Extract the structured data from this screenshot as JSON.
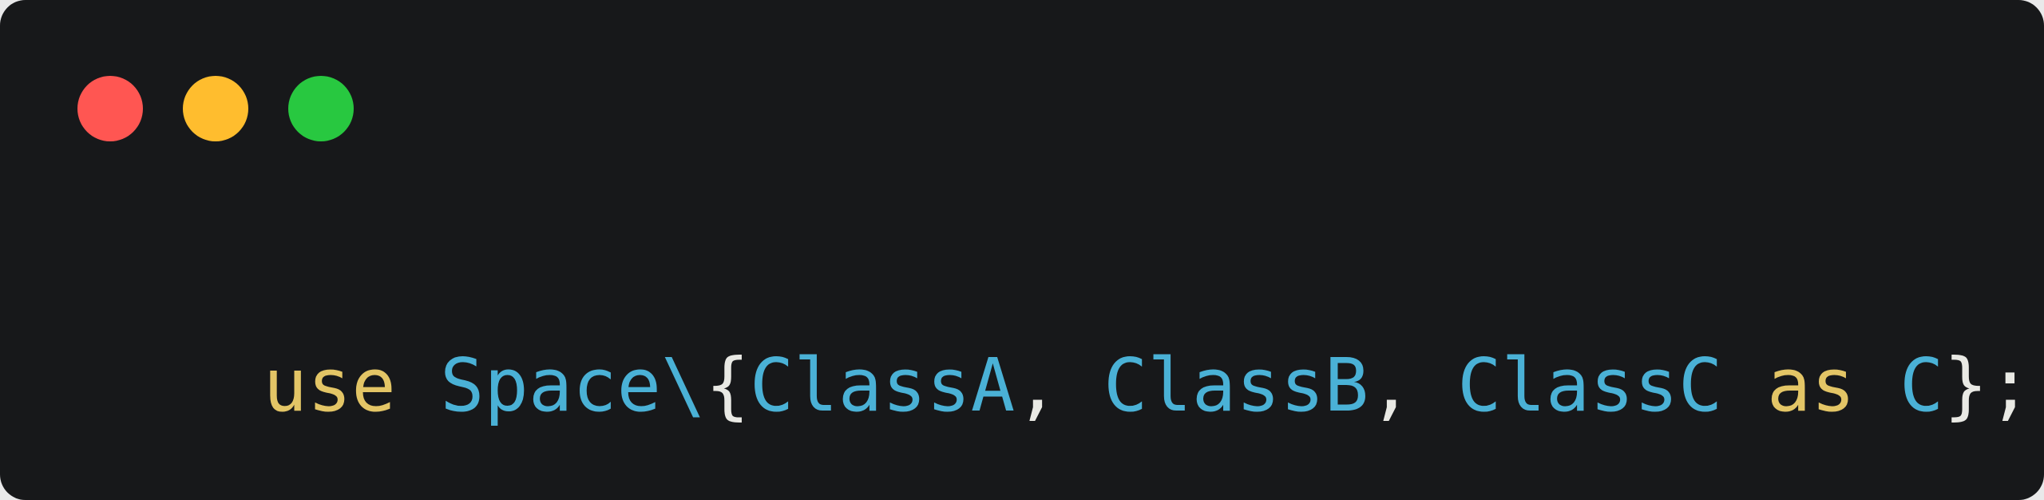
{
  "window": {
    "controls": [
      {
        "name": "close-button",
        "color": "#ff5652"
      },
      {
        "name": "minimize-button",
        "color": "#ffbd2e"
      },
      {
        "name": "zoom-button",
        "color": "#28c840"
      }
    ]
  },
  "code": {
    "tokens": [
      {
        "text": "use",
        "kind": "keyword"
      },
      {
        "text": " ",
        "kind": "punct"
      },
      {
        "text": "Space",
        "kind": "class"
      },
      {
        "text": "\\",
        "kind": "class"
      },
      {
        "text": "{",
        "kind": "punct"
      },
      {
        "text": "ClassA",
        "kind": "class"
      },
      {
        "text": ", ",
        "kind": "punct"
      },
      {
        "text": "ClassB",
        "kind": "class"
      },
      {
        "text": ", ",
        "kind": "punct"
      },
      {
        "text": "ClassC",
        "kind": "class"
      },
      {
        "text": " ",
        "kind": "punct"
      },
      {
        "text": "as",
        "kind": "keyword"
      },
      {
        "text": " ",
        "kind": "punct"
      },
      {
        "text": "C",
        "kind": "class"
      },
      {
        "text": "};",
        "kind": "punct"
      }
    ]
  },
  "colors": {
    "background": "#17181a",
    "keyword": "#e3c566",
    "class": "#4ab1d6",
    "punct": "#e9e9e4"
  }
}
